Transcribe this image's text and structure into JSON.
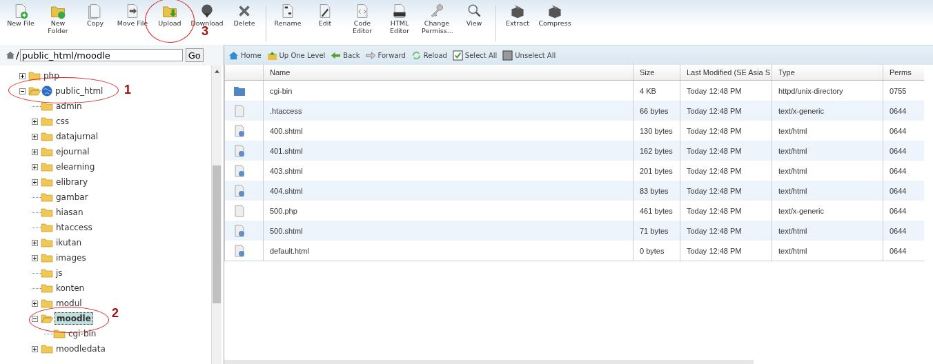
{
  "toolbar": {
    "groups": [
      [
        {
          "label": "New File"
        },
        {
          "label": "New Folder"
        },
        {
          "label": "Copy"
        },
        {
          "label": "Move File"
        },
        {
          "label": "Upload"
        },
        {
          "label": "Download"
        },
        {
          "label": "Delete"
        }
      ],
      [
        {
          "label": "Rename"
        },
        {
          "label": "Edit"
        },
        {
          "label": "Code Editor"
        },
        {
          "label": "HTML Editor"
        },
        {
          "label": "Change Permiss..."
        },
        {
          "label": "View"
        }
      ],
      [
        {
          "label": "Extract"
        },
        {
          "label": "Compress"
        }
      ]
    ]
  },
  "path_bar": {
    "value": "public_html/moodle",
    "separator": "/",
    "go_button": "Go"
  },
  "tree": [
    {
      "label": "php",
      "kind": "folder",
      "expandable": true,
      "expanded": false,
      "selected": false
    },
    {
      "label": "public_html",
      "kind": "webroot",
      "expandable": true,
      "expanded": true,
      "selected": false,
      "children": [
        {
          "label": "admin",
          "kind": "folder",
          "expandable": false,
          "expanded": false,
          "selected": false
        },
        {
          "label": "css",
          "kind": "folder",
          "expandable": true,
          "expanded": false,
          "selected": false
        },
        {
          "label": "datajurnal",
          "kind": "folder",
          "expandable": true,
          "expanded": false,
          "selected": false
        },
        {
          "label": "ejournal",
          "kind": "folder",
          "expandable": true,
          "expanded": false,
          "selected": false
        },
        {
          "label": "elearning",
          "kind": "folder",
          "expandable": true,
          "expanded": false,
          "selected": false
        },
        {
          "label": "elibrary",
          "kind": "folder",
          "expandable": true,
          "expanded": false,
          "selected": false
        },
        {
          "label": "gambar",
          "kind": "folder",
          "expandable": false,
          "expanded": false,
          "selected": false
        },
        {
          "label": "hiasan",
          "kind": "folder",
          "expandable": false,
          "expanded": false,
          "selected": false
        },
        {
          "label": "htaccess",
          "kind": "folder",
          "expandable": false,
          "expanded": false,
          "selected": false
        },
        {
          "label": "ikutan",
          "kind": "folder",
          "expandable": true,
          "expanded": false,
          "selected": false
        },
        {
          "label": "images",
          "kind": "folder",
          "expandable": true,
          "expanded": false,
          "selected": false
        },
        {
          "label": "js",
          "kind": "folder",
          "expandable": false,
          "expanded": false,
          "selected": false
        },
        {
          "label": "konten",
          "kind": "folder",
          "expandable": false,
          "expanded": false,
          "selected": false
        },
        {
          "label": "modul",
          "kind": "folder",
          "expandable": true,
          "expanded": false,
          "selected": false
        },
        {
          "label": "moodle",
          "kind": "folder",
          "expandable": true,
          "expanded": true,
          "selected": true,
          "children": [
            {
              "label": "cgi-bin",
              "kind": "folder",
              "expandable": false,
              "expanded": false,
              "selected": false
            }
          ]
        },
        {
          "label": "moodledata",
          "kind": "folder",
          "expandable": true,
          "expanded": false,
          "selected": false
        }
      ]
    }
  ],
  "nav_bar": [
    {
      "label": "Home"
    },
    {
      "label": "Up One Level"
    },
    {
      "label": "Back"
    },
    {
      "label": "Forward"
    },
    {
      "label": "Reload"
    },
    {
      "label": "Select All"
    },
    {
      "label": "Unselect All"
    }
  ],
  "table": {
    "columns": [
      "",
      "Name",
      "Size",
      "Last Modified (SE Asia S",
      "Type",
      "Perms"
    ],
    "rows": [
      {
        "kind": "folder",
        "name": "cgi-bin",
        "size": "4 KB",
        "modified": "Today 12:48 PM",
        "type": "httpd/unix-directory",
        "perms": "0755"
      },
      {
        "kind": "text",
        "name": ".htaccess",
        "size": "66 bytes",
        "modified": "Today 12:48 PM",
        "type": "text/x-generic",
        "perms": "0644"
      },
      {
        "kind": "web",
        "name": "400.shtml",
        "size": "130 bytes",
        "modified": "Today 12:48 PM",
        "type": "text/html",
        "perms": "0644"
      },
      {
        "kind": "web",
        "name": "401.shtml",
        "size": "162 bytes",
        "modified": "Today 12:48 PM",
        "type": "text/html",
        "perms": "0644"
      },
      {
        "kind": "web",
        "name": "403.shtml",
        "size": "201 bytes",
        "modified": "Today 12:48 PM",
        "type": "text/html",
        "perms": "0644"
      },
      {
        "kind": "web",
        "name": "404.shtml",
        "size": "83 bytes",
        "modified": "Today 12:48 PM",
        "type": "text/html",
        "perms": "0644"
      },
      {
        "kind": "text",
        "name": "500.php",
        "size": "461 bytes",
        "modified": "Today 12:48 PM",
        "type": "text/x-generic",
        "perms": "0644"
      },
      {
        "kind": "web",
        "name": "500.shtml",
        "size": "71 bytes",
        "modified": "Today 12:48 PM",
        "type": "text/html",
        "perms": "0644"
      },
      {
        "kind": "web",
        "name": "default.html",
        "size": "0 bytes",
        "modified": "Today 12:48 PM",
        "type": "text/html",
        "perms": "0644"
      }
    ]
  },
  "annotations": [
    {
      "label": "1"
    },
    {
      "label": "2"
    },
    {
      "label": "3"
    }
  ]
}
